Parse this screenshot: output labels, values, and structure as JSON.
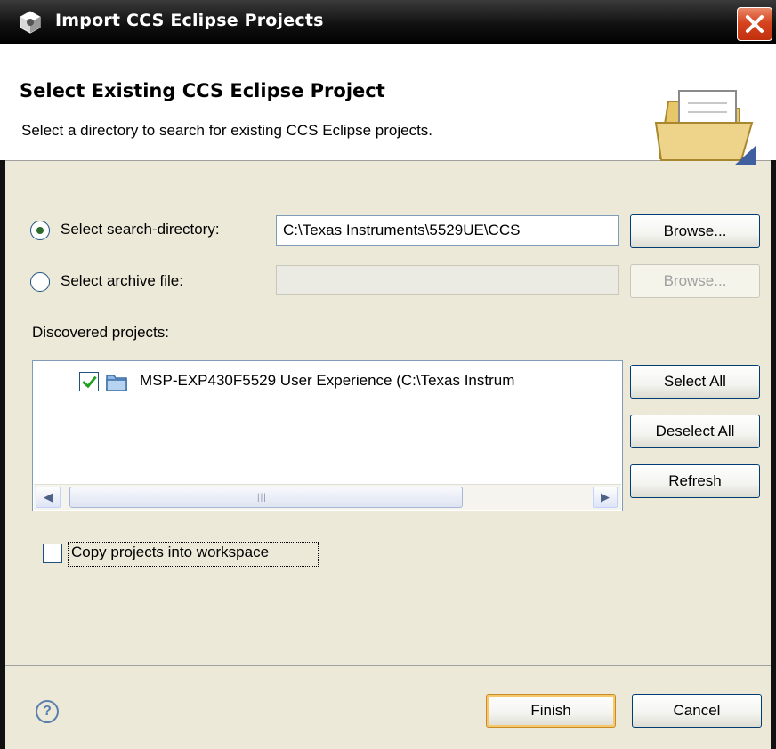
{
  "window": {
    "title": "Import CCS Eclipse Projects",
    "icon": "gear-cube-icon",
    "close_icon": "close-icon"
  },
  "header": {
    "title": "Select Existing CCS Eclipse Project",
    "description": "Select a directory to search for existing CCS Eclipse projects.",
    "icon": "open-folder-icon"
  },
  "source": {
    "search_directory_label": "Select search-directory:",
    "search_directory_value": "C:\\Texas Instruments\\5529UE\\CCS",
    "search_directory_selected": true,
    "archive_file_label": "Select archive file:",
    "archive_file_value": "",
    "archive_file_selected": false,
    "browse_label": "Browse..."
  },
  "projects": {
    "label": "Discovered projects:",
    "items": [
      {
        "label": "MSP-EXP430F5529 User Experience  (C:\\Texas Instrum",
        "checked": true
      }
    ],
    "select_all_label": "Select All",
    "deselect_all_label": "Deselect All",
    "refresh_label": "Refresh"
  },
  "options": {
    "copy_label": "Copy projects into workspace",
    "copy_checked": false
  },
  "footer": {
    "finish_label": "Finish",
    "cancel_label": "Cancel"
  },
  "colors": {
    "titlebar": "#111111",
    "dialog_background": "#ece9d8",
    "close_button": "#d6451f"
  }
}
